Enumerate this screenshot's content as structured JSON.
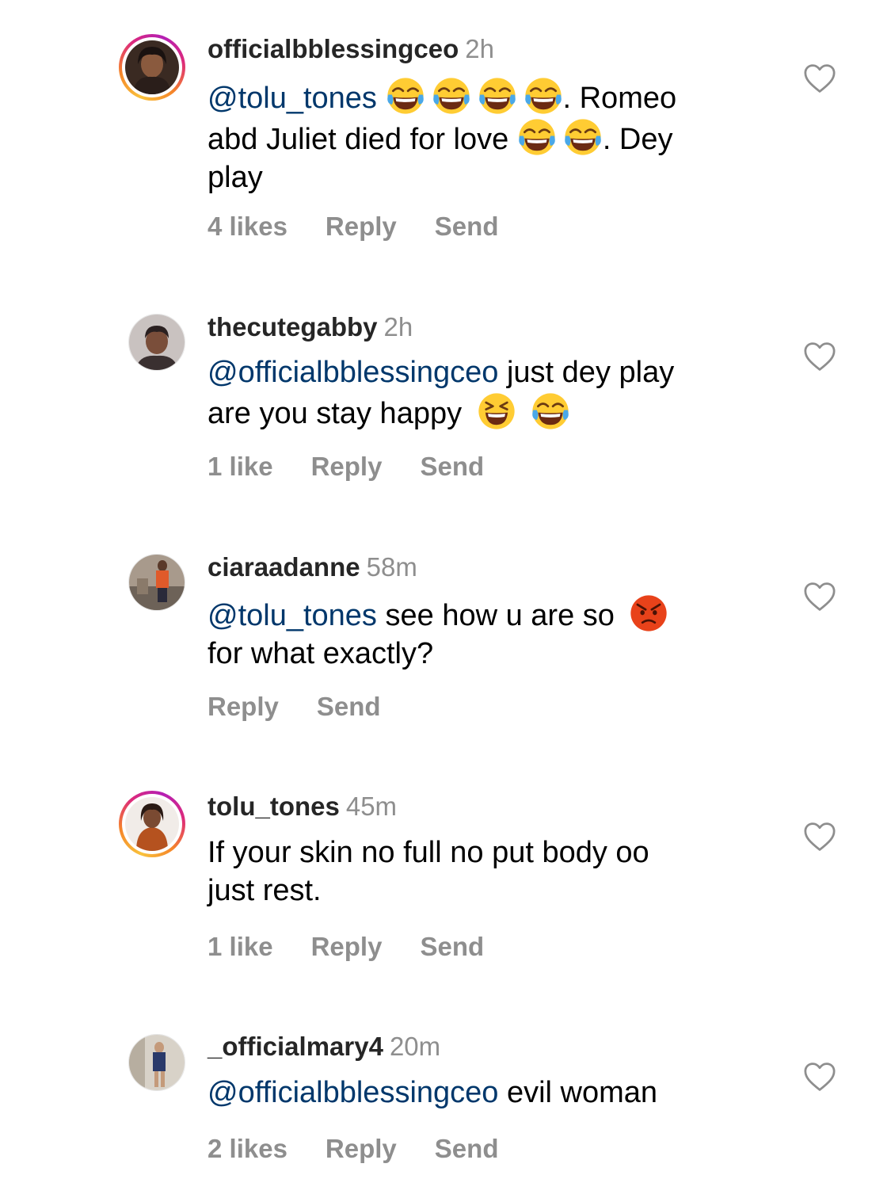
{
  "comments": [
    {
      "username": "officialbblessingceo",
      "time": "2h",
      "avatar_ring": true,
      "body": {
        "line1_mention": "@tolu_tones",
        "line1_after": ". Romeo",
        "line2_before": "abd Juliet died for love",
        "line2_after": ". Dey",
        "line3": "play"
      },
      "emoji_line1": [
        "face-with-tears-of-joy",
        "face-with-tears-of-joy",
        "face-with-tears-of-joy",
        "face-with-tears-of-joy"
      ],
      "emoji_line2": [
        "face-with-tears-of-joy",
        "face-with-tears-of-joy"
      ],
      "likes": "4 likes",
      "reply": "Reply",
      "send": "Send"
    },
    {
      "username": "thecutegabby",
      "time": "2h",
      "avatar_ring": false,
      "body": {
        "line1_mention": "@officialbblessingceo",
        "line1_after": " just dey play",
        "line2_before": "are you stay happy"
      },
      "emoji_line2": [
        "grinning-squinting-face",
        "face-with-tears-of-joy"
      ],
      "likes": "1 like",
      "reply": "Reply",
      "send": "Send"
    },
    {
      "username": "ciaraadanne",
      "time": "58m",
      "avatar_ring": false,
      "body": {
        "line1_mention": "@tolu_tones",
        "line1_after": " see how u are so",
        "line2": "for what exactly?"
      },
      "emoji_line1": [
        "pouting-face"
      ],
      "reply": "Reply",
      "send": "Send"
    },
    {
      "username": "tolu_tones",
      "time": "45m",
      "avatar_ring": true,
      "body": {
        "line1": "If your skin no full no put body oo",
        "line2": "just rest."
      },
      "likes": "1 like",
      "reply": "Reply",
      "send": "Send"
    },
    {
      "username": "_officialmary4",
      "time": "20m",
      "avatar_ring": false,
      "body": {
        "line1_mention": "@officialbblessingceo",
        "line1_after": " evil woman"
      },
      "likes": "2 likes",
      "reply": "Reply",
      "send": "Send"
    }
  ],
  "colors": {
    "mention": "#00376b",
    "meta": "#8e8e8e",
    "username": "#262626"
  },
  "icons": {
    "like": "heart-outline-icon"
  }
}
